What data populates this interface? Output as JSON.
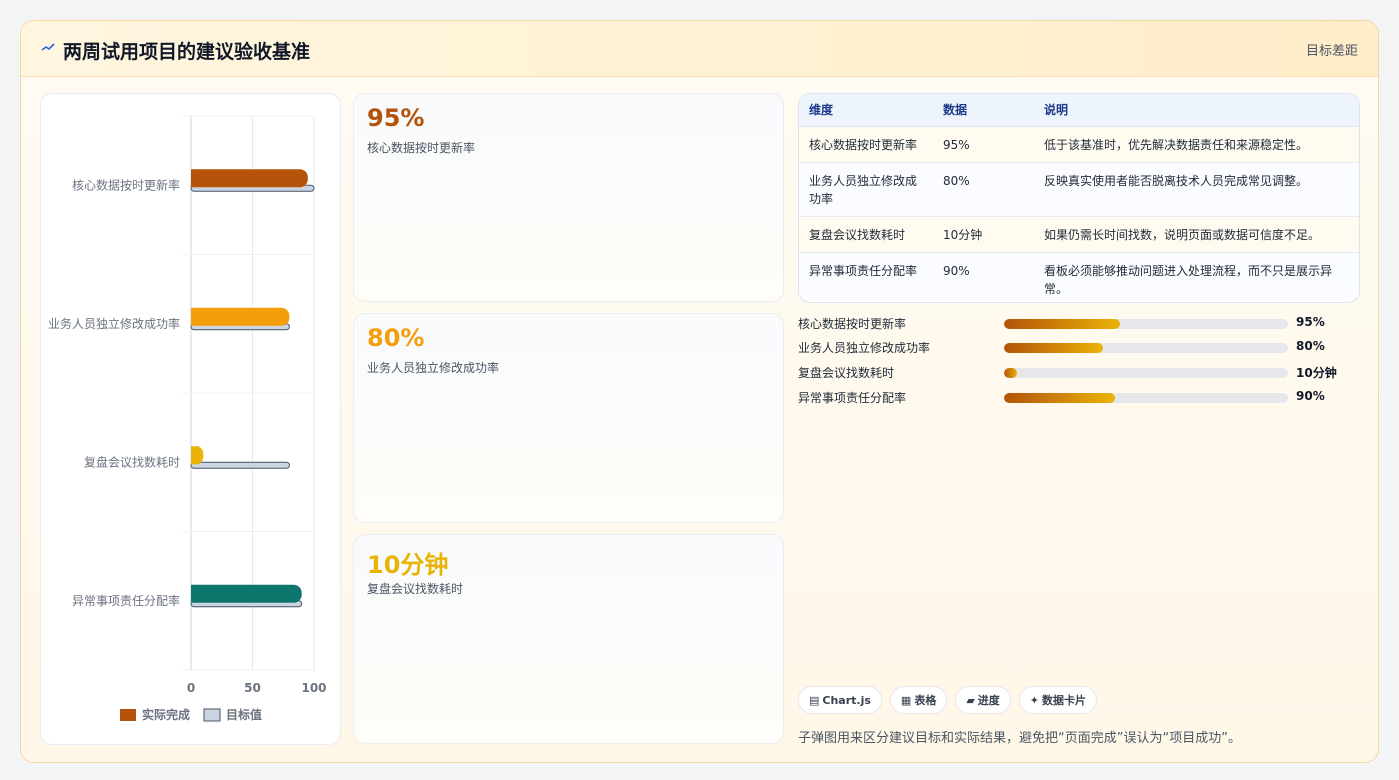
{
  "header": {
    "title": "两周试用项目的建议验收基准",
    "link": "目标差距"
  },
  "chart_data": {
    "type": "bar",
    "orientation": "horizontal",
    "categories": [
      "核心数据按时更新率",
      "业务人员独立修改成功率",
      "复盘会议找数耗时",
      "异常事项责任分配率"
    ],
    "series": [
      {
        "name": "实际完成",
        "values": [
          95,
          80,
          10,
          90
        ],
        "colors": [
          "#b45309",
          "#f59e0b",
          "#eab308",
          "#0f766e"
        ]
      },
      {
        "name": "目标值",
        "values": [
          100,
          80,
          80,
          90
        ],
        "color": "#cbd5e1"
      }
    ],
    "xlim": [
      0,
      100
    ],
    "xticks": [
      0,
      50,
      100
    ],
    "legend": "bottom",
    "grid": true
  },
  "stat_cards": [
    {
      "value": "95%",
      "label": "核心数据按时更新率",
      "color": "#b45309"
    },
    {
      "value": "80%",
      "label": "业务人员独立修改成功率",
      "color": "#f59e0b"
    },
    {
      "value": "10分钟",
      "label": "复盘会议找数耗时",
      "color": "#eab308"
    }
  ],
  "table": {
    "headers": [
      "维度",
      "数据",
      "说明"
    ],
    "rows": [
      [
        "核心数据按时更新率",
        "95%",
        "低于该基准时，优先解决数据责任和来源稳定性。"
      ],
      [
        "业务人员独立修改成功率",
        "80%",
        "反映真实使用者能否脱离技术人员完成常见调整。"
      ],
      [
        "复盘会议找数耗时",
        "10分钟",
        "如果仍需长时间找数，说明页面或数据可信度不足。"
      ],
      [
        "异常事项责任分配率",
        "90%",
        "看板必须能够推动问题进入处理流程，而不只是展示异常。"
      ]
    ]
  },
  "progress": [
    {
      "label": "核心数据按时更新率",
      "value": "95%",
      "fraction": 0.41
    },
    {
      "label": "业务人员独立修改成功率",
      "value": "80%",
      "fraction": 0.35
    },
    {
      "label": "复盘会议找数耗时",
      "value": "10分钟",
      "fraction": 0.045
    },
    {
      "label": "异常事项责任分配率",
      "value": "90%",
      "fraction": 0.39
    }
  ],
  "chips": [
    {
      "icon": "chart-icon",
      "glyph": "▤",
      "label": "Chart.js"
    },
    {
      "icon": "table-icon",
      "glyph": "▦",
      "label": "表格"
    },
    {
      "icon": "progress-icon",
      "glyph": "▰",
      "label": "进度"
    },
    {
      "icon": "data-card-icon",
      "glyph": "✦",
      "label": "数据卡片"
    }
  ],
  "footnote": "子弹图用来区分建议目标和实际结果，避免把“页面完成”误认为“项目成功”。"
}
